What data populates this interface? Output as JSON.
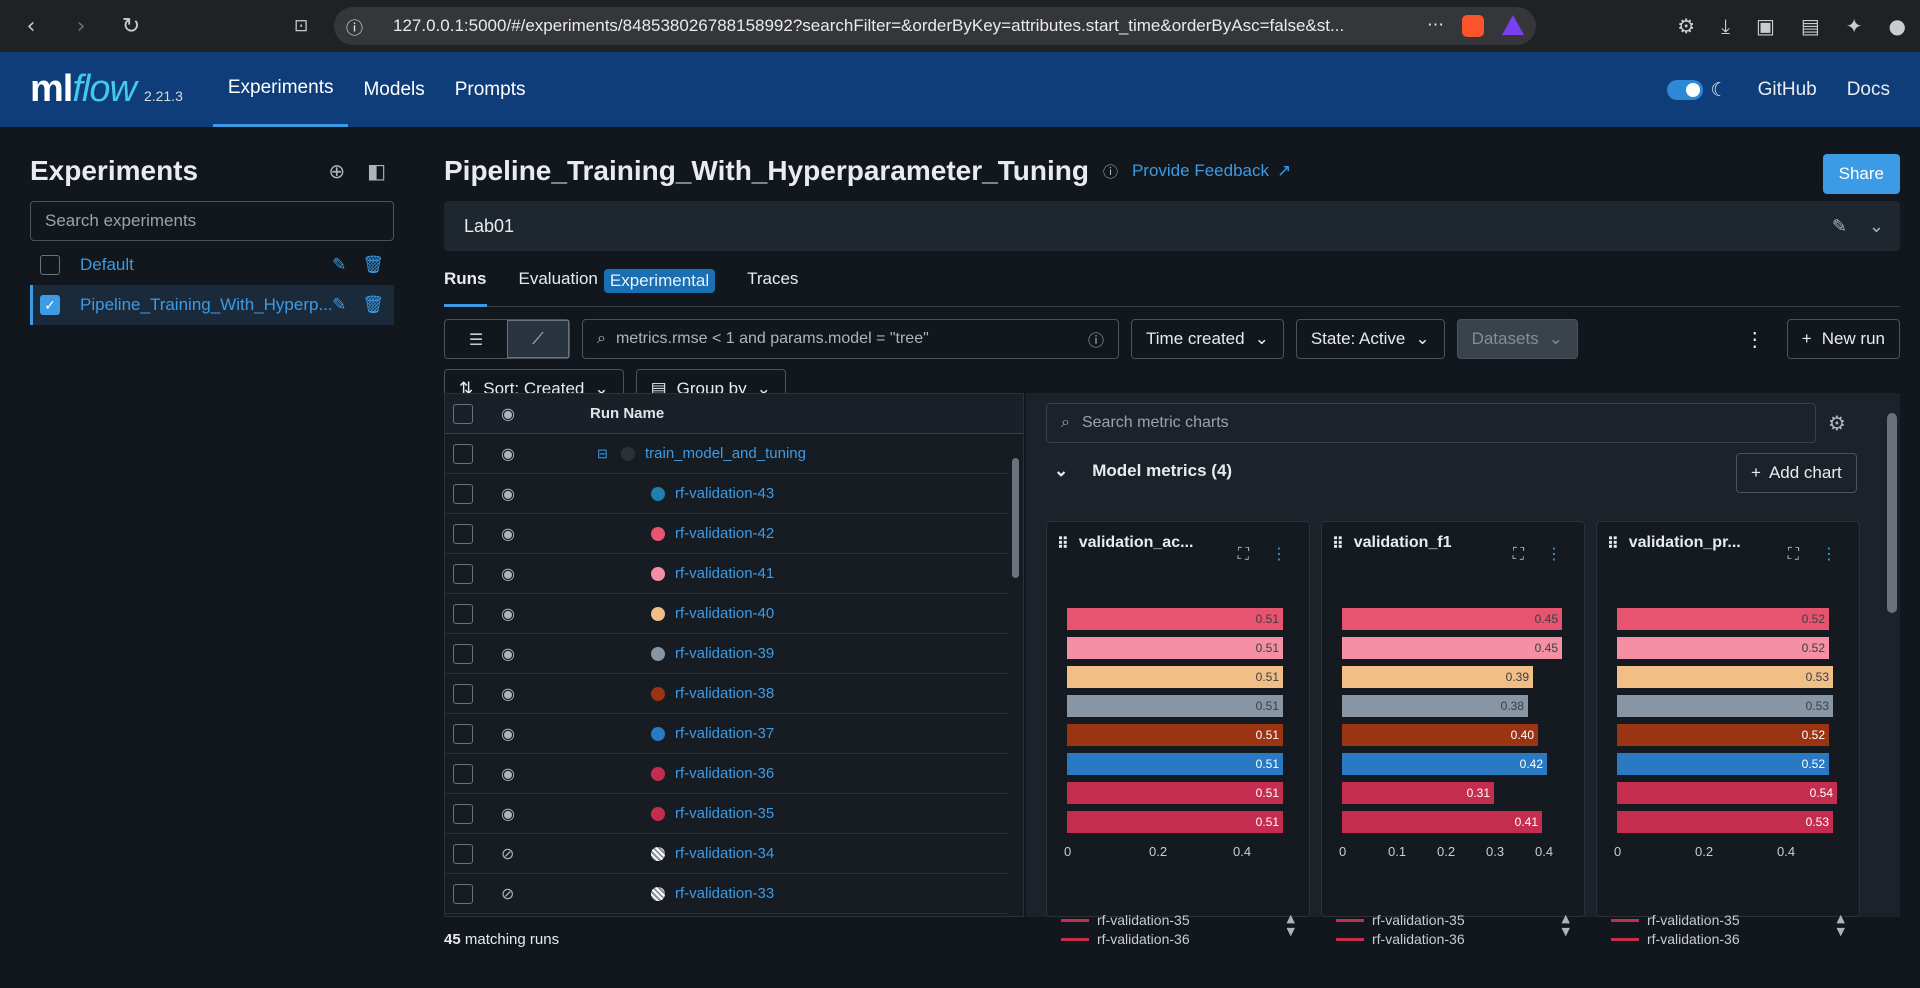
{
  "browser": {
    "url": "127.0.0.1:5000/#/experiments/848538026788158992?searchFilter=&orderByKey=attributes.start_time&orderByAsc=false&st..."
  },
  "app": {
    "logo_ml": "ml",
    "logo_flow": "flow",
    "version": "2.21.3",
    "nav": [
      "Experiments",
      "Models",
      "Prompts"
    ],
    "github": "GitHub",
    "docs": "Docs"
  },
  "sidebar": {
    "title": "Experiments",
    "search_placeholder": "Search experiments",
    "items": [
      {
        "label": "Default",
        "checked": false
      },
      {
        "label": "Pipeline_Training_With_Hyperp...",
        "checked": true
      }
    ]
  },
  "experiment": {
    "title": "Pipeline_Training_With_Hyperparameter_Tuning",
    "feedback": "Provide Feedback",
    "share": "Share",
    "description": "Lab01"
  },
  "tabs": {
    "runs": "Runs",
    "evaluation": "Evaluation",
    "experimental": "Experimental",
    "traces": "Traces"
  },
  "toolbar": {
    "search_placeholder": "metrics.rmse < 1 and params.model = \"tree\"",
    "time_created": "Time created",
    "state": "State: Active",
    "datasets": "Datasets",
    "new_run": "New run",
    "sort": "Sort: Created",
    "group_by": "Group by"
  },
  "runs_table": {
    "header": "Run Name",
    "matching_count": "45",
    "matching_label": "matching runs",
    "parent": "train_model_and_tuning",
    "rows": [
      {
        "name": "rf-validation-43",
        "color": "#1f7fb0",
        "visible": true
      },
      {
        "name": "rf-validation-42",
        "color": "#e8536f",
        "visible": true
      },
      {
        "name": "rf-validation-41",
        "color": "#f58fa6",
        "visible": true
      },
      {
        "name": "rf-validation-40",
        "color": "#f1be86",
        "visible": true
      },
      {
        "name": "rf-validation-39",
        "color": "#8696a4",
        "visible": true
      },
      {
        "name": "rf-validation-38",
        "color": "#9a3412",
        "visible": true
      },
      {
        "name": "rf-validation-37",
        "color": "#2a7ac3",
        "visible": true
      },
      {
        "name": "rf-validation-36",
        "color": "#c52d4e",
        "visible": true
      },
      {
        "name": "rf-validation-35",
        "color": "#c52d4e",
        "visible": true
      },
      {
        "name": "rf-validation-34",
        "color": "hatched",
        "visible": false
      },
      {
        "name": "rf-validation-33",
        "color": "hatched",
        "visible": false
      }
    ]
  },
  "charts": {
    "search_placeholder": "Search metric charts",
    "section": "Model metrics (4)",
    "add_chart": "Add chart",
    "bar_colors": [
      "#e8536f",
      "#f58fa6",
      "#f1be86",
      "#8696a4",
      "#9a3412",
      "#2a7ac3",
      "#c52d4e",
      "#c52d4e"
    ],
    "items": [
      {
        "title": "validation_ac...",
        "max": 0.52,
        "values": [
          "0.51",
          "0.51",
          "0.51",
          "0.51",
          "0.51",
          "0.51",
          "0.51",
          "0.51"
        ],
        "ticks": [
          "0",
          "0.2",
          "0.4"
        ],
        "tick_vals": [
          0,
          0.2,
          0.4
        ]
      },
      {
        "title": "validation_f1",
        "max": 0.45,
        "values": [
          "0.45",
          "0.45",
          "0.39",
          "0.38",
          "0.40",
          "0.42",
          "0.31",
          "0.41"
        ],
        "ticks": [
          "0",
          "0.1",
          "0.2",
          "0.3",
          "0.4"
        ],
        "tick_vals": [
          0,
          0.1,
          0.2,
          0.3,
          0.4
        ]
      },
      {
        "title": "validation_pr...",
        "max": 0.54,
        "values": [
          "0.52",
          "0.52",
          "0.53",
          "0.53",
          "0.52",
          "0.52",
          "0.54",
          "0.53"
        ],
        "ticks": [
          "0",
          "0.2",
          "0.4"
        ],
        "tick_vals": [
          0,
          0.2,
          0.4
        ]
      }
    ],
    "legend": [
      "rf-validation-35",
      "rf-validation-36"
    ]
  }
}
